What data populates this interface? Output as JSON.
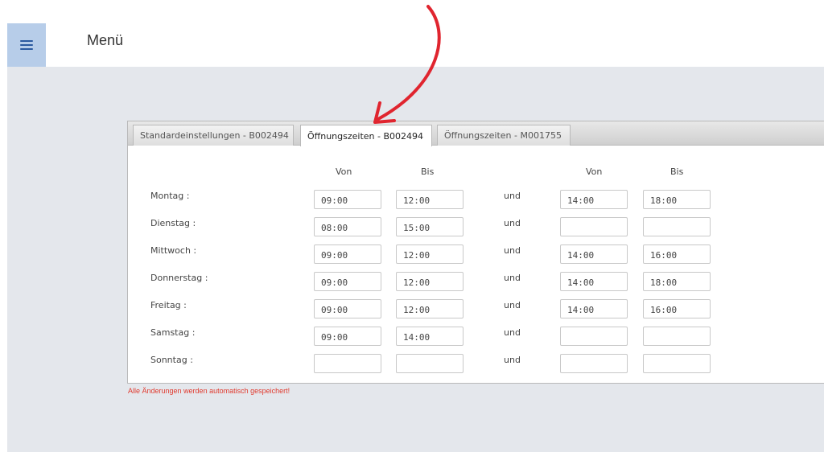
{
  "header": {
    "menu_label": "Menü"
  },
  "tabs": [
    {
      "label": "Standardeinstellungen - B002494",
      "active": false
    },
    {
      "label": "Öffnungszeiten - B002494",
      "active": true
    },
    {
      "label": "Öffnungszeiten - M001755",
      "active": false
    }
  ],
  "columns": {
    "von1": "Von",
    "bis1": "Bis",
    "von2": "Von",
    "bis2": "Bis"
  },
  "und_label": "und",
  "days": [
    {
      "label": "Montag :",
      "von1": "09:00",
      "bis1": "12:00",
      "von2": "14:00",
      "bis2": "18:00"
    },
    {
      "label": "Dienstag :",
      "von1": "08:00",
      "bis1": "15:00",
      "von2": "",
      "bis2": ""
    },
    {
      "label": "Mittwoch :",
      "von1": "09:00",
      "bis1": "12:00",
      "von2": "14:00",
      "bis2": "16:00"
    },
    {
      "label": "Donnerstag :",
      "von1": "09:00",
      "bis1": "12:00",
      "von2": "14:00",
      "bis2": "18:00"
    },
    {
      "label": "Freitag :",
      "von1": "09:00",
      "bis1": "12:00",
      "von2": "14:00",
      "bis2": "16:00"
    },
    {
      "label": "Samstag :",
      "von1": "09:00",
      "bis1": "14:00",
      "von2": "",
      "bis2": ""
    },
    {
      "label": "Sonntag :",
      "von1": "",
      "bis1": "",
      "von2": "",
      "bis2": ""
    }
  ],
  "footer_note": "Alle Änderungen werden automatisch gespeichert!",
  "colors": {
    "accent": "#b7cde9",
    "note": "#e03a2e",
    "arrow": "#e0252f",
    "background": "#e4e7ec"
  },
  "icons": {
    "menu": "hamburger-icon",
    "annotation": "red-arrow-annotation"
  }
}
